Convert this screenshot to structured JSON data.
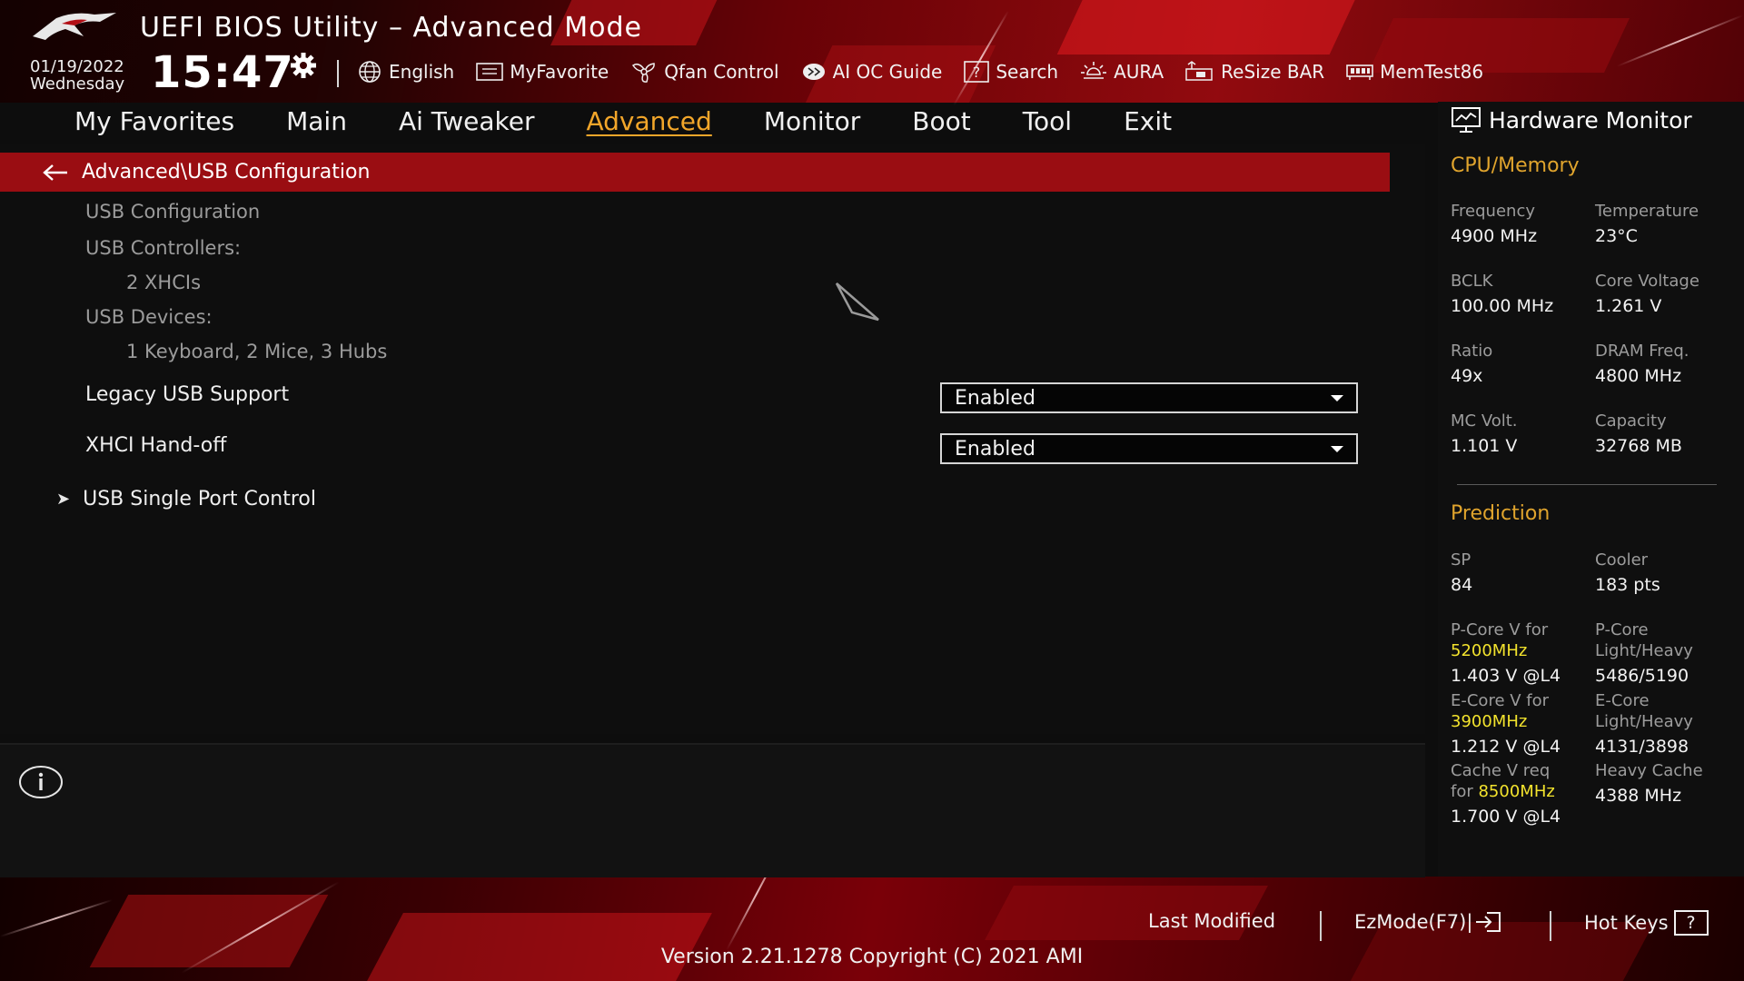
{
  "header": {
    "title": "UEFI BIOS Utility – Advanced Mode",
    "date": "01/19/2022",
    "weekday": "Wednesday",
    "time": "15:47"
  },
  "toolbar": [
    {
      "label": "English",
      "icon": "globe-icon"
    },
    {
      "label": "MyFavorite",
      "icon": "favorite-list-icon"
    },
    {
      "label": "Qfan Control",
      "icon": "fan-icon"
    },
    {
      "label": "AI OC Guide",
      "icon": "ai-oc-guide-icon"
    },
    {
      "label": "Search",
      "icon": "search-question-icon"
    },
    {
      "label": "AURA",
      "icon": "aura-light-icon"
    },
    {
      "label": "ReSize BAR",
      "icon": "resize-bar-icon"
    },
    {
      "label": "MemTest86",
      "icon": "memory-test-icon"
    }
  ],
  "tabs": [
    {
      "label": "My Favorites",
      "active": false
    },
    {
      "label": "Main",
      "active": false
    },
    {
      "label": "Ai Tweaker",
      "active": false
    },
    {
      "label": "Advanced",
      "active": true
    },
    {
      "label": "Monitor",
      "active": false
    },
    {
      "label": "Boot",
      "active": false
    },
    {
      "label": "Tool",
      "active": false
    },
    {
      "label": "Exit",
      "active": false
    }
  ],
  "breadcrumb": "Advanced\\USB Configuration",
  "settings": {
    "usb_configuration_heading": "USB Configuration",
    "usb_controllers_label": "USB Controllers:",
    "usb_controllers_value": "2 XHCIs",
    "usb_devices_label": "USB Devices:",
    "usb_devices_value": "1 Keyboard, 2 Mice, 3 Hubs",
    "legacy_usb_support": {
      "label": "Legacy USB Support",
      "value": "Enabled"
    },
    "xhci_handoff": {
      "label": "XHCI Hand-off",
      "value": "Enabled"
    },
    "submenu": "USB Single Port Control"
  },
  "hw_monitor": {
    "title": "Hardware Monitor",
    "cpu_memory_title": "CPU/Memory",
    "frequency_label": "Frequency",
    "frequency_value": "4900 MHz",
    "temperature_label": "Temperature",
    "temperature_value": "23°C",
    "bclk_label": "BCLK",
    "bclk_value": "100.00 MHz",
    "core_voltage_label": "Core Voltage",
    "core_voltage_value": "1.261 V",
    "ratio_label": "Ratio",
    "ratio_value": "49x",
    "dram_freq_label": "DRAM Freq.",
    "dram_freq_value": "4800 MHz",
    "mc_volt_label": "MC Volt.",
    "mc_volt_value": "1.101 V",
    "capacity_label": "Capacity",
    "capacity_value": "32768 MB",
    "prediction_title": "Prediction",
    "sp_label": "SP",
    "sp_value": "84",
    "cooler_label": "Cooler",
    "cooler_value": "183 pts",
    "pcore_v_label": "P-Core V for",
    "pcore_v_freq": "5200MHz",
    "pcore_v_value": "1.403 V @L4",
    "pcore_lh_label1": "P-Core",
    "pcore_lh_label2": "Light/Heavy",
    "pcore_lh_value": "5486/5190",
    "ecore_v_label": "E-Core V for",
    "ecore_v_freq": "3900MHz",
    "ecore_v_value": "1.212 V @L4",
    "ecore_lh_label1": "E-Core",
    "ecore_lh_label2": "Light/Heavy",
    "ecore_lh_value": "4131/3898",
    "cache_v_label1": "Cache V req",
    "cache_v_label2": "for",
    "cache_v_freq": "8500MHz",
    "cache_v_value": "1.700 V @L4",
    "heavy_cache_label": "Heavy Cache",
    "heavy_cache_value": "4388 MHz"
  },
  "footer": {
    "last_modified": "Last Modified",
    "ezmode": "EzMode(F7)|",
    "hotkeys": "Hot Keys",
    "hotkeys_key": "?",
    "version": "Version 2.21.1278 Copyright (C) 2021 AMI"
  },
  "colors": {
    "accent_orange": "#f2a62a",
    "breadcrumb_red": "#9a0d12",
    "highlight_yellow": "#f3e32d"
  }
}
